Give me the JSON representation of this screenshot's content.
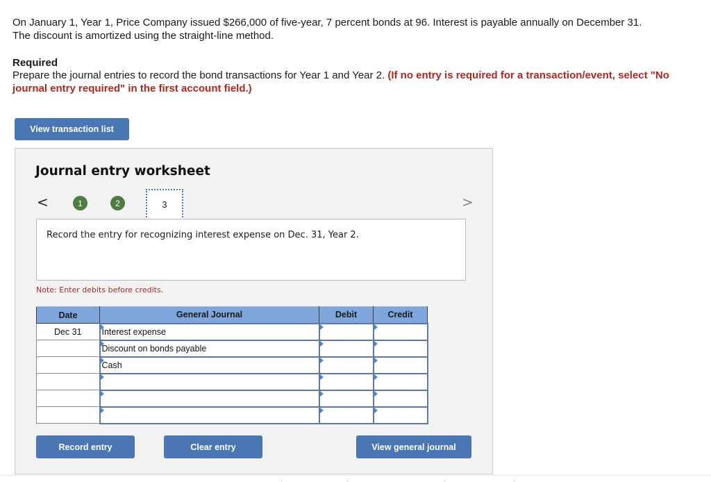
{
  "problem": {
    "line1": "On January 1, Year 1, Price Company issued $266,000 of five-year, 7 percent bonds at 96. Interest is payable annually on December 31.",
    "line2": "The discount is amortized using the straight-line method."
  },
  "required": {
    "heading": "Required",
    "text": "Prepare the journal entries to record the bond transactions for Year 1 and Year 2. ",
    "emphasis": "(If no entry is required for a transaction/event, select \"No journal entry required\" in the first account field.)"
  },
  "buttons": {
    "view_transaction_list": "View transaction list",
    "record_entry": "Record entry",
    "clear_entry": "Clear entry",
    "view_general_journal": "View general journal"
  },
  "worksheet": {
    "title": "Journal entry worksheet",
    "nav_prev": "<",
    "nav_next": ">",
    "steps": [
      {
        "label": "1",
        "status": "completed"
      },
      {
        "label": "2",
        "status": "completed"
      },
      {
        "label": "3",
        "status": "current"
      }
    ],
    "instruction": "Record the entry for recognizing interest expense on Dec. 31, Year 2.",
    "note": "Note: Enter debits before credits."
  },
  "journal_table": {
    "headers": [
      "Date",
      "General Journal",
      "Debit",
      "Credit"
    ],
    "rows": [
      {
        "date": "Dec 31",
        "account": "Interest expense",
        "debit": "",
        "credit": ""
      },
      {
        "date": "",
        "account": "Discount on bonds payable",
        "debit": "",
        "credit": ""
      },
      {
        "date": "",
        "account": "Cash",
        "debit": "",
        "credit": ""
      },
      {
        "date": "",
        "account": "",
        "debit": "",
        "credit": ""
      },
      {
        "date": "",
        "account": "",
        "debit": "",
        "credit": ""
      },
      {
        "date": "",
        "account": "",
        "debit": "",
        "credit": ""
      }
    ]
  },
  "colors": {
    "accent_button": "#4a76b3",
    "step_completed": "#4e7d44",
    "header_fill": "#7ea6dc",
    "emphasis_red": "#b0281f"
  }
}
